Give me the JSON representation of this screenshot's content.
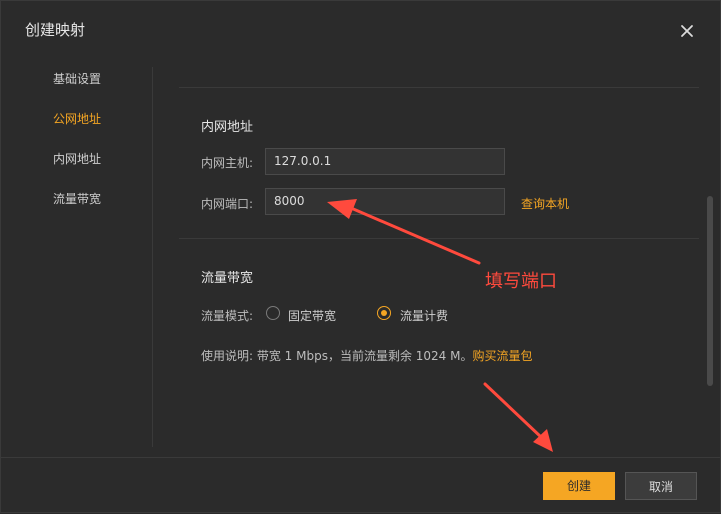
{
  "dialog": {
    "title": "创建映射"
  },
  "sidebar": {
    "items": [
      {
        "label": "基础设置"
      },
      {
        "label": "公网地址"
      },
      {
        "label": "内网地址"
      },
      {
        "label": "流量带宽"
      }
    ]
  },
  "internal": {
    "title": "内网地址",
    "host_label": "内网主机:",
    "host_value": "127.0.0.1",
    "port_label": "内网端口:",
    "port_value": "8000",
    "query_link": "查询本机"
  },
  "bandwidth": {
    "title": "流量带宽",
    "mode_label": "流量模式:",
    "options": [
      {
        "label": "固定带宽",
        "selected": false
      },
      {
        "label": "流量计费",
        "selected": true
      }
    ],
    "note_prefix": "使用说明:  带宽 1 Mbps，当前流量剩余 1024 M。",
    "buy_link": "购买流量包"
  },
  "annotation": {
    "text": "填写端口"
  },
  "footer": {
    "create_label": "创建",
    "cancel_label": "取消"
  },
  "colors": {
    "accent": "#f5a623",
    "annotation": "#ff4a3d"
  }
}
